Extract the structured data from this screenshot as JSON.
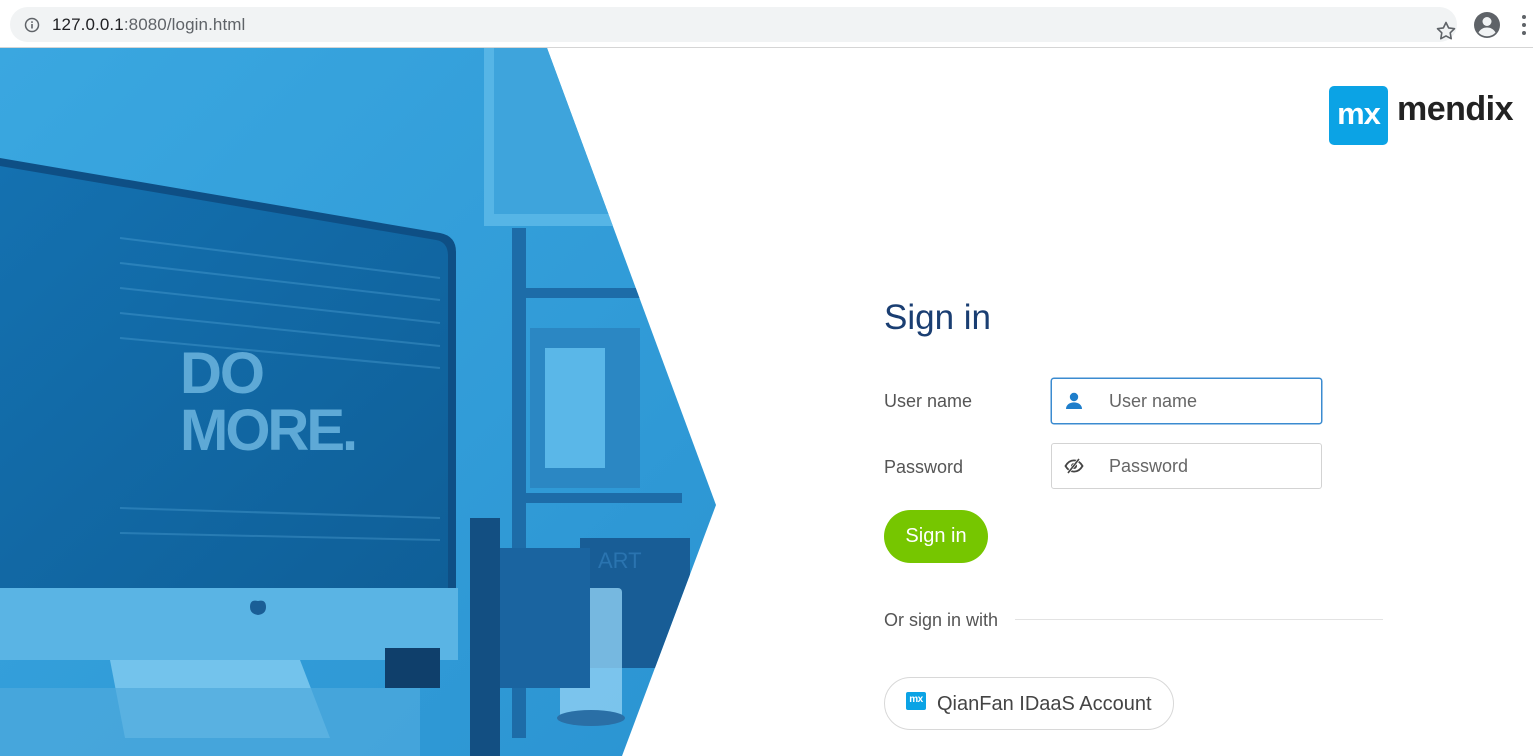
{
  "browser": {
    "url_host": "127.0.0.1",
    "url_port": ":8080",
    "url_path": "/login.html"
  },
  "hero": {
    "poster_line1": "DO",
    "poster_line2": "MORE."
  },
  "logo": {
    "badge_text": "mx",
    "wordmark": "mendix",
    "brand_color": "#0ba3e5"
  },
  "form": {
    "title": "Sign in",
    "username": {
      "label": "User name",
      "placeholder": "User name",
      "value": ""
    },
    "password": {
      "label": "Password",
      "placeholder": "Password",
      "value": ""
    },
    "submit_label": "Sign in",
    "submit_color": "#76c600",
    "divider_text": "Or sign in with",
    "sso": {
      "badge_text": "mx",
      "label": "QianFan IDaaS Account"
    }
  },
  "icons": {
    "info": "info-icon",
    "star": "star-icon",
    "account": "account-icon",
    "menu": "menu-icon",
    "user": "user-icon",
    "password": "eye-icon"
  }
}
